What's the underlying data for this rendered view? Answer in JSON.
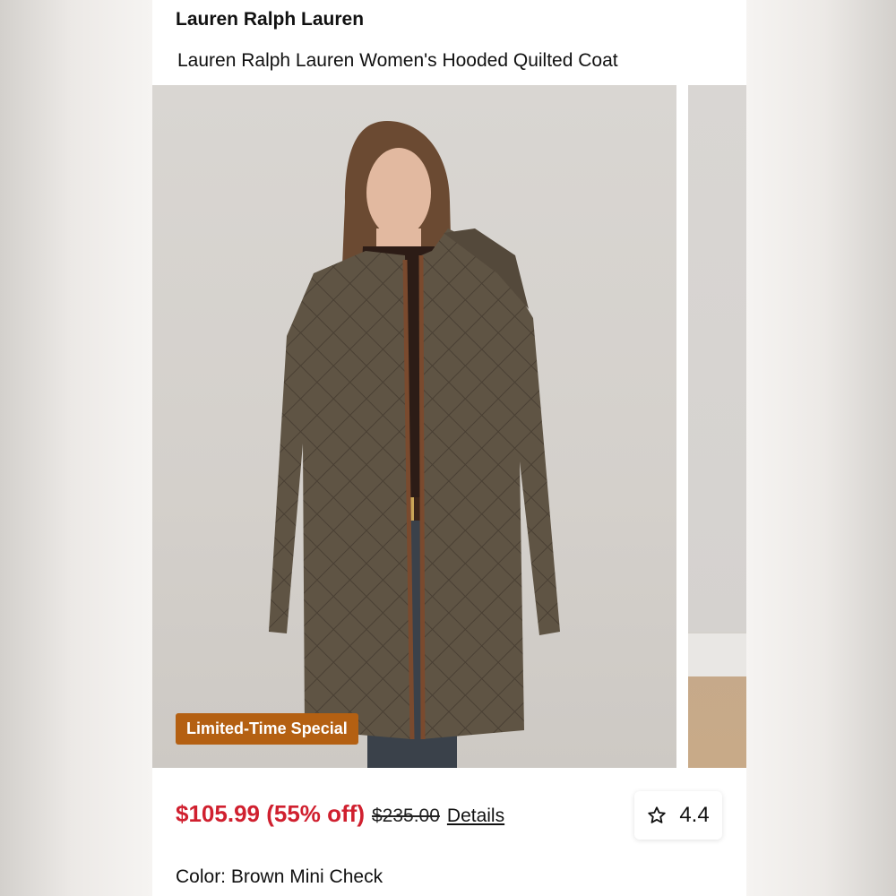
{
  "product": {
    "brand": "Lauren Ralph Lauren",
    "title": "Lauren Ralph Lauren Women's Hooded Quilted Coat",
    "badge": "Limited-Time Special",
    "price": "$105.99 (55% off)",
    "original_price": "$235.00",
    "details_label": "Details",
    "rating": "4.4",
    "color_label": "Color: Brown Mini Check"
  },
  "colors": {
    "price_red": "#d0202f",
    "badge_orange": "#b46012",
    "coat_brown": "#5f5444"
  },
  "icons": {
    "rating": "star-outline-icon"
  }
}
